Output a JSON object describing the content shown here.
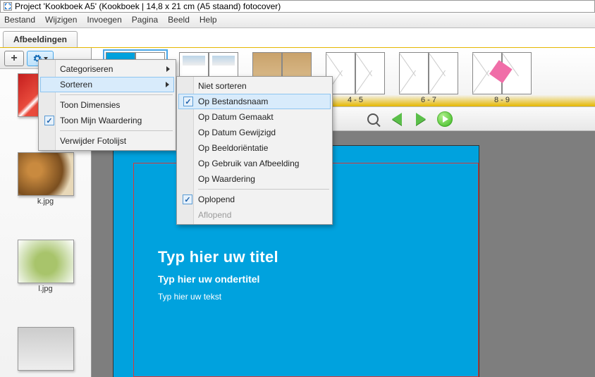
{
  "window": {
    "title": "Project 'Kookboek A5' (Kookboek | 14,8 x 21 cm (A5 staand) fotocover)"
  },
  "menubar": {
    "items": [
      "Bestand",
      "Wijzigen",
      "Invoegen",
      "Pagina",
      "Beeld",
      "Help"
    ]
  },
  "sidebar": {
    "tab_label": "Afbeeldingen",
    "thumbs": [
      {
        "label": ""
      },
      {
        "label": "k.jpg"
      },
      {
        "label": "l.jpg"
      },
      {
        "label": ""
      }
    ]
  },
  "context_menu1": {
    "items": [
      {
        "label": "Categoriseren",
        "submenu": true
      },
      {
        "label": "Sorteren",
        "submenu": true,
        "hover": true
      },
      {
        "sep": true
      },
      {
        "label": "Toon Dimensies"
      },
      {
        "label": "Toon Mijn Waardering",
        "checked": true
      },
      {
        "sep": true
      },
      {
        "label": "Verwijder Fotolijst"
      }
    ]
  },
  "context_menu2": {
    "items": [
      {
        "label": "Niet sorteren"
      },
      {
        "label": "Op Bestandsnaam",
        "checked": true,
        "hover": true
      },
      {
        "label": "Op Datum Gemaakt"
      },
      {
        "label": "Op Datum Gewijzigd"
      },
      {
        "label": "Op Beeldoriëntatie"
      },
      {
        "label": "Op Gebruik van Afbeelding"
      },
      {
        "label": "Op Waardering"
      },
      {
        "sep": true
      },
      {
        "label": "Oplopend",
        "checked": true
      },
      {
        "label": "Aflopend",
        "disabled": true
      }
    ]
  },
  "spreads": [
    {
      "label": ""
    },
    {
      "label": ""
    },
    {
      "label": ""
    },
    {
      "label": "4 - 5"
    },
    {
      "label": "6 - 7"
    },
    {
      "label": "8 - 9"
    }
  ],
  "page": {
    "title_placeholder": "Typ hier uw titel",
    "subtitle_placeholder": "Typ hier uw ondertitel",
    "body_placeholder": "Typ hier uw tekst"
  },
  "colors": {
    "accent": "#00a2de",
    "margin_guide": "#d83a3a"
  }
}
